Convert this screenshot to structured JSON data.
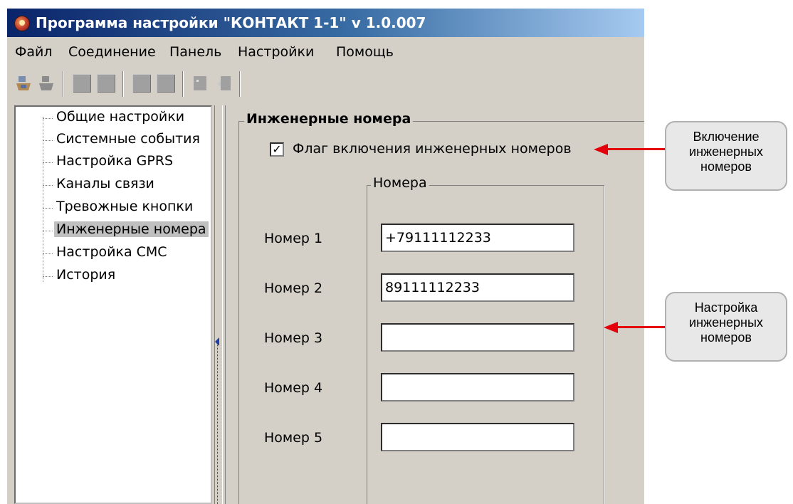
{
  "window": {
    "title": "Программа настройки \"КОНТАКТ 1-1\" v 1.0.007"
  },
  "menu": {
    "items": [
      "Файл",
      "Соединение",
      "Панель",
      "Настройки",
      "Помощь"
    ]
  },
  "tree": {
    "items": [
      "Общие настройки",
      "Системные события",
      "Настройка GPRS",
      "Каналы связи",
      "Тревожные кнопки",
      "Инженерные номера",
      "Настройка СМС",
      "История"
    ],
    "selected": "Инженерные номера"
  },
  "content": {
    "group_title": "Инженерные номера",
    "checkbox_label": "Флаг включения инженерных номеров",
    "checkbox_checked": true,
    "checkbox_mark": "✓",
    "numbers_group_title": "Номера",
    "numbers": [
      {
        "label": "Номер 1",
        "value": "+79111112233"
      },
      {
        "label": "Номер 2",
        "value": "89111112233"
      },
      {
        "label": "Номер 3",
        "value": ""
      },
      {
        "label": "Номер 4",
        "value": ""
      },
      {
        "label": "Номер 5",
        "value": ""
      }
    ]
  },
  "annotations": {
    "enable": [
      "Включение",
      "инженерных",
      "номеров"
    ],
    "settings": [
      "Настройка",
      "инженерных",
      "номеров"
    ]
  },
  "colors": {
    "arrow": "#e3000b",
    "window_face": "#d4d0c8",
    "title_bar": "#0a246a"
  }
}
